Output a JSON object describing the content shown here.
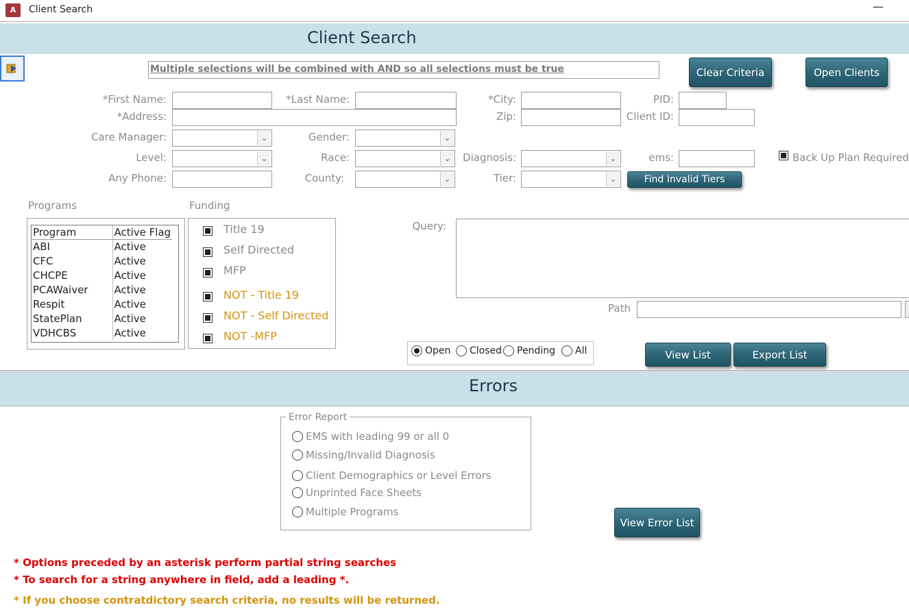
{
  "window": {
    "title": "Client Search",
    "app_icon": "A",
    "minimize_glyph": "—"
  },
  "header": {
    "title": "Client Search",
    "nav_icon": "record-selector-icon"
  },
  "hint": "Multiple selections will be combined with AND so all selections must be true",
  "buttons": {
    "clear_criteria": "Clear Criteria",
    "open_clients": "Open Clients",
    "find_invalid_tiers": "Find Invalid Tiers",
    "view_list": "View List",
    "export_list": "Export List",
    "view_error_list": "View Error List"
  },
  "fields": {
    "first_name": {
      "label": "*First Name:",
      "value": ""
    },
    "last_name": {
      "label": "*Last Name:",
      "value": ""
    },
    "city": {
      "label": "*City:",
      "value": ""
    },
    "pid": {
      "label": "PID:",
      "value": ""
    },
    "address": {
      "label": "*Address:",
      "value": ""
    },
    "zip": {
      "label": "Zip:",
      "value": ""
    },
    "client_id": {
      "label": "Client ID:",
      "value": ""
    },
    "care_manager": {
      "label": "Care Manager:",
      "value": ""
    },
    "gender": {
      "label": "Gender:",
      "value": ""
    },
    "level": {
      "label": "Level:",
      "value": ""
    },
    "race": {
      "label": "Race:",
      "value": ""
    },
    "diagnosis": {
      "label": "Diagnosis:",
      "value": ""
    },
    "ems": {
      "label": "ems:",
      "value": ""
    },
    "any_phone": {
      "label": "Any Phone:",
      "value": ""
    },
    "county": {
      "label": "County:",
      "value": ""
    },
    "tier": {
      "label": "Tier:",
      "value": ""
    },
    "query": {
      "label": "Query:",
      "value": ""
    },
    "path": {
      "label": "Path",
      "value": ""
    }
  },
  "backup_plan": {
    "label": "Back Up Plan Required",
    "checked": true
  },
  "programs": {
    "section_label": "Programs",
    "headers": [
      "Program",
      "Active Flag"
    ],
    "rows": [
      [
        "ABI",
        "Active"
      ],
      [
        "CFC",
        "Active"
      ],
      [
        "CHCPE",
        "Active"
      ],
      [
        "PCAWaiver",
        "Active"
      ],
      [
        "Respit",
        "Active"
      ],
      [
        "StatePlan",
        "Active"
      ],
      [
        "VDHCBS",
        "Active"
      ]
    ]
  },
  "funding": {
    "section_label": "Funding",
    "items": [
      {
        "label": "Title 19",
        "checked": true,
        "color": "#8a8a8a"
      },
      {
        "label": "Self Directed",
        "checked": true,
        "color": "#8a8a8a"
      },
      {
        "label": "MFP",
        "checked": true,
        "color": "#8a8a8a"
      },
      {
        "label": "NOT - Title 19",
        "checked": true,
        "color": "#d4930e"
      },
      {
        "label": "NOT - Self Directed",
        "checked": true,
        "color": "#d4930e"
      },
      {
        "label": "NOT -MFP",
        "checked": true,
        "color": "#d4930e"
      }
    ]
  },
  "status_filter": {
    "options": [
      "Open",
      "Closed",
      "Pending",
      "All"
    ],
    "selected": "Open"
  },
  "errors": {
    "title": "Errors",
    "report_label": "Error Report",
    "options": [
      "EMS with leading 99 or all 0",
      "Missing/Invalid Diagnosis",
      "Client Demographics or Level Errors",
      "Unprinted Face Sheets",
      "Multiple Programs"
    ]
  },
  "notes": [
    {
      "text": "* Options preceded by an asterisk perform partial string searches",
      "color": "#e00000"
    },
    {
      "text": "* To search for a string anywhere in field, add a leading *.",
      "color": "#e00000"
    },
    {
      "text": "* If you choose contratdictory search criteria, no results will be returned.",
      "color": "#d4930e"
    }
  ],
  "combo_arrow": "⌄",
  "colors": {
    "band": "#c9e0e8",
    "button": "#2e6677",
    "accent_red": "#e00000",
    "accent_gold": "#d4930e"
  }
}
